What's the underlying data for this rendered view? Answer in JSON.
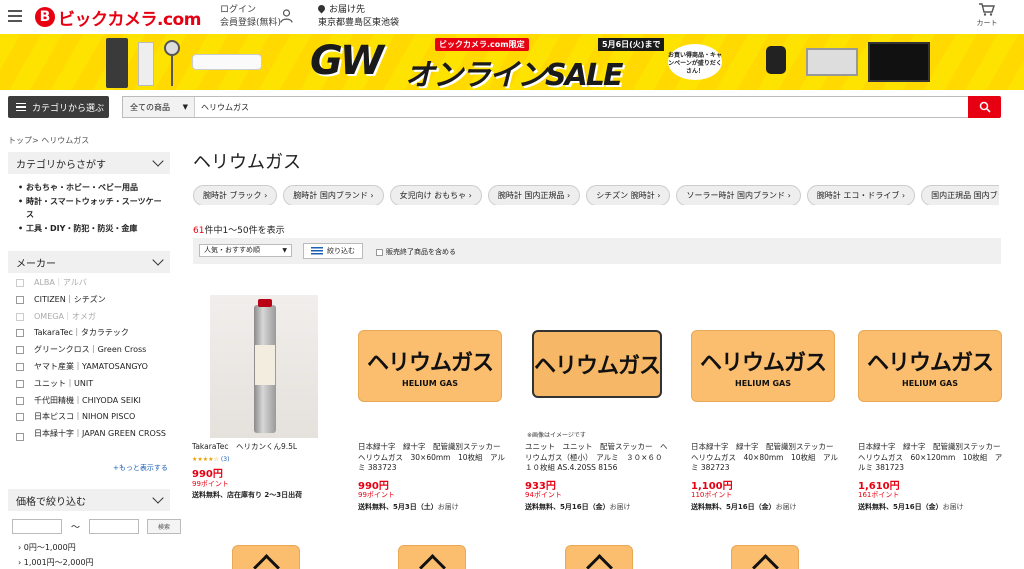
{
  "header": {
    "logo_mark": "B",
    "logo_text": "ビックカメラ.com",
    "login_label": "ログイン",
    "register_label": "会員登録(無料)",
    "deliver_label": "お届け先",
    "deliver_address": "東京都豊島区東池袋",
    "cart_label": "カート"
  },
  "banner": {
    "gw_text": "GW",
    "sale_text": "オンラインSALE",
    "tag": "ビックカメラ.com限定",
    "date": "5月6日(火)まで",
    "campaign": "お買い得商品・キャンペーンが盛りだくさん！"
  },
  "search": {
    "category_button": "カテゴリから選ぶ",
    "scope": "全ての商品",
    "query": "ヘリウムガス"
  },
  "breadcrumb": "トップ> ヘリウムガス",
  "sidebar": {
    "category_heading": "カテゴリからさがす",
    "categories": [
      "おもちゃ・ホビー・ベビー用品",
      "時計・スマートウォッチ・スーツケース",
      "工具・DIY・防犯・防災・金庫"
    ],
    "maker_heading": "メーカー",
    "makers": [
      {
        "label": "ALBA｜アルバ",
        "disabled": true
      },
      {
        "label": "CITIZEN｜シチズン",
        "disabled": false
      },
      {
        "label": "OMEGA｜オメガ",
        "disabled": true
      },
      {
        "label": "TakaraTec｜タカラテック",
        "disabled": false
      },
      {
        "label": "グリーンクロス｜Green Cross",
        "disabled": false
      },
      {
        "label": "ヤマト産業｜YAMATOSANGYO",
        "disabled": false
      },
      {
        "label": "ユニット｜UNIT",
        "disabled": false
      },
      {
        "label": "千代田精機｜CHIYODA SEIKI",
        "disabled": false
      },
      {
        "label": "日本ピスコ｜NIHON PISCO",
        "disabled": false
      },
      {
        "label": "日本緑十字｜JAPAN GREEN CROSS",
        "disabled": false
      }
    ],
    "more_label": "+もっと表示する",
    "price_heading": "価格で絞り込む",
    "price_search_button": "検索",
    "price_dash": "～",
    "price_ranges": [
      "0円〜1,000円",
      "1,001円〜2,000円"
    ]
  },
  "main": {
    "title": "ヘリウムガス",
    "chips": [
      "腕時計 ブラック",
      "腕時計 国内ブランド",
      "女児向け おもちゃ",
      "腕時計 国内正規品",
      "シチズン 腕時計",
      "ソーラー時計 国内ブランド",
      "腕時計 エコ・ドライブ",
      "国内正規品 国内ブランド"
    ],
    "count_number": "61",
    "count_text": "件中1〜50件を表示",
    "sort_label": "人気・おすすめ順",
    "filter_label": "絞り込む",
    "include_label": "販売終了商品を含める"
  },
  "products": [
    {
      "name": "TakaraTec　ヘリカンくん9.5L",
      "stars": "★★★★☆",
      "review_count": "(3)",
      "price": "990円",
      "points": "99ポイント",
      "shipping": "送料無料、店在庫有り 2〜3日出荷",
      "ship_suffix": ""
    },
    {
      "name": "日本緑十字　緑十字　配管識別ステッカー　ヘリウムガス　30×60mm　10枚組　アルミ 383723",
      "sticker_text": "ヘリウムガス",
      "sticker_sub": "HELIUM GAS",
      "price": "990円",
      "points": "99ポイント",
      "shipping": "送料無料、5月3日（土）",
      "ship_suffix": "お届け"
    },
    {
      "name": "ユニット　ユニット　配管ステッカー　ヘリウムガス（極小）　アルミ　３０×６０　１０枚組 AS.4.20SS 8156",
      "sticker_text": "ヘリウムガス",
      "note": "※画像はイメージです",
      "price": "933円",
      "points": "94ポイント",
      "shipping": "送料無料、5月16日（金）",
      "ship_suffix": "お届け"
    },
    {
      "name": "日本緑十字　緑十字　配管識別ステッカー　ヘリウムガス　40×80mm　10枚組　アルミ 382723",
      "sticker_text": "ヘリウムガス",
      "sticker_sub": "HELIUM GAS",
      "price": "1,100円",
      "points": "110ポイント",
      "shipping": "送料無料、5月16日（金）",
      "ship_suffix": "お届け"
    },
    {
      "name": "日本緑十字　緑十字　配管識別ステッカー　ヘリウムガス　60×120mm　10枚組　アルミ 381723",
      "sticker_text": "ヘリウムガス",
      "sticker_sub": "HELIUM GAS",
      "price": "1,610円",
      "points": "161ポイント",
      "shipping": "送料無料、5月16日（金）",
      "ship_suffix": "お届け"
    }
  ],
  "icons": {
    "hamburger": "hamburger-icon",
    "user": "user-icon",
    "pin": "location-pin-icon",
    "cart": "cart-icon",
    "search": "search-icon",
    "filter": "filter-icon"
  },
  "colors": {
    "brand_red": "#e60012",
    "banner_yellow": "#ffe300",
    "sticker_orange": "#fbbd6e",
    "link_blue": "#1b5fb4"
  }
}
